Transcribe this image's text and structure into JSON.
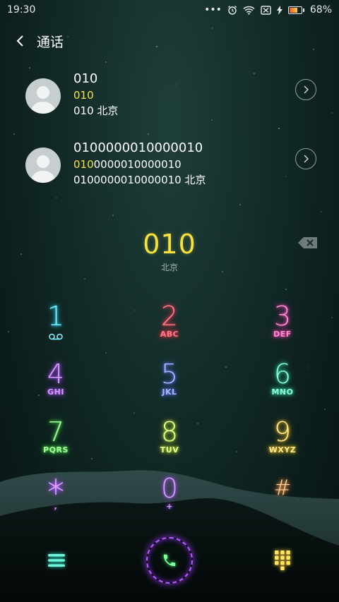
{
  "status_bar": {
    "time": "19:30",
    "battery_percent": "68%",
    "battery_level": 0.68
  },
  "header": {
    "title": "通话"
  },
  "contacts": [
    {
      "name": "010",
      "number_highlight": "010",
      "number_rest": "",
      "number_suffix": "010",
      "location": "北京"
    },
    {
      "name": "0100000010000010",
      "number_highlight": "010",
      "number_rest": "0000010000010",
      "number_suffix": "0100000010000010",
      "location": "北京"
    }
  ],
  "entered": {
    "digits": "010",
    "region": "北京"
  },
  "keypad": [
    {
      "num": "1",
      "sub": "",
      "sub_icon": "voicemail-icon",
      "color": "#2ce6ff"
    },
    {
      "num": "2",
      "sub": "ABC",
      "color": "#ff3f55"
    },
    {
      "num": "3",
      "sub": "DEF",
      "color": "#ff4fbf"
    },
    {
      "num": "4",
      "sub": "GHI",
      "color": "#b25cff"
    },
    {
      "num": "5",
      "sub": "JKL",
      "color": "#6d86ff"
    },
    {
      "num": "6",
      "sub": "MNO",
      "color": "#3de8b2"
    },
    {
      "num": "7",
      "sub": "PQRS",
      "color": "#5af05a"
    },
    {
      "num": "8",
      "sub": "TUV",
      "color": "#c9f33d"
    },
    {
      "num": "9",
      "sub": "WXYZ",
      "color": "#ffd23a"
    },
    {
      "num": "＊",
      "sub": ",",
      "color": "#b25cff"
    },
    {
      "num": "0",
      "sub": "+",
      "color": "#b25cff"
    },
    {
      "num": "#",
      "sub": "",
      "color": "#ff9c4a"
    }
  ],
  "bottom_bar": {
    "menu_icon": "menu-icon",
    "call_icon": "phone-icon",
    "dialpad_icon": "dialpad-icon"
  },
  "colors": {
    "accent_yellow": "#f7e23e",
    "call_ring": "#b85cff"
  }
}
